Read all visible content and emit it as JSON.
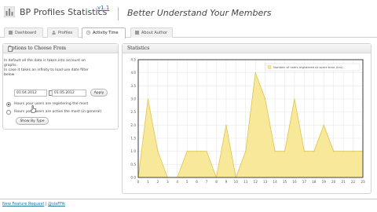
{
  "header": {
    "title": "BP Profiles Statistics",
    "version": "v1.1",
    "tagline": "Better Understand Your Members"
  },
  "tabs": [
    {
      "label": "Dashboard",
      "active": false
    },
    {
      "label": "Profiles",
      "active": false
    },
    {
      "label": "Activity Time",
      "active": true
    },
    {
      "label": "About Author",
      "active": false
    }
  ],
  "options": {
    "heading": "Options to Choose From",
    "desc_lines": [
      "In default all the data is taken into account on",
      "graphs.",
      "In case it takes an infinity to load use date filter",
      "below"
    ],
    "date_from": "01.04.2012",
    "date_to": "01.05.2012",
    "apply_label": "Apply",
    "radio1_label": "Hours your users are registering the most",
    "radio2_label": "Hours your users are active the most (in general)",
    "show_label": "Show By Type"
  },
  "stats": {
    "heading": "Statistics"
  },
  "chart_data": {
    "type": "area",
    "x": [
      0,
      1,
      2,
      3,
      4,
      5,
      6,
      7,
      8,
      9,
      10,
      11,
      12,
      13,
      14,
      15,
      16,
      17,
      18,
      19,
      20,
      21,
      22,
      23
    ],
    "values": [
      0,
      3,
      1,
      0,
      0,
      1,
      1,
      1,
      0,
      2,
      0,
      1,
      4,
      3,
      1,
      1,
      3,
      1,
      1,
      2,
      1,
      1,
      1,
      1
    ],
    "series_name": "Number of users registered at some time (hrs)",
    "ylim": [
      0,
      4.5
    ],
    "yticks": [
      "4.5",
      "4.0",
      "3.5",
      "3.0",
      "2.5",
      "2.0",
      "1.5",
      "1.0",
      "0.5",
      "0.0"
    ],
    "legend_position": "top-right",
    "grid": true,
    "fill_color": "#f7e89a",
    "line_color": "#e0c44a"
  },
  "footer": {
    "request_label": "New Feature Request",
    "separator": " | ",
    "author_label": "@slaFFik"
  }
}
